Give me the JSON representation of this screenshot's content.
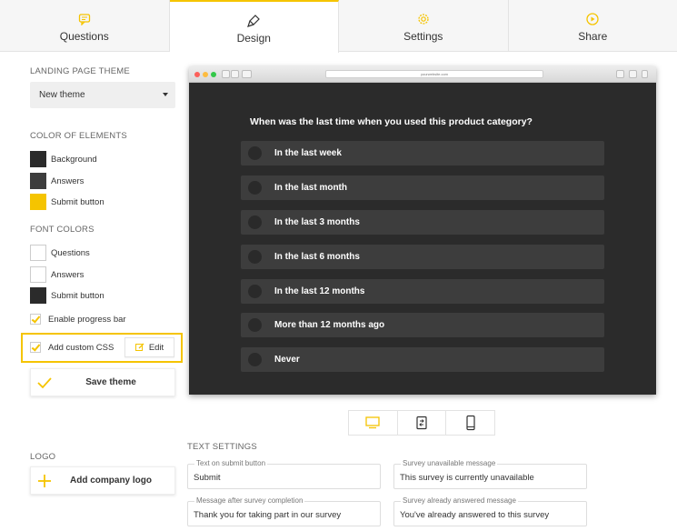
{
  "tabs": [
    {
      "label": "Questions",
      "icon": "chat-icon"
    },
    {
      "label": "Design",
      "icon": "paintbrush-icon"
    },
    {
      "label": "Settings",
      "icon": "gear-icon"
    },
    {
      "label": "Share",
      "icon": "play-circle-icon"
    }
  ],
  "active_tab": "Design",
  "left": {
    "landing_theme_label": "LANDING PAGE THEME",
    "theme_select_value": "New theme",
    "color_elements_label": "COLOR OF ELEMENTS",
    "color_elements": [
      {
        "label": "Background",
        "color": "#2b2b2b"
      },
      {
        "label": "Answers",
        "color": "#3d3d3d"
      },
      {
        "label": "Submit button",
        "color": "#f5c400"
      }
    ],
    "font_colors_label": "FONT COLORS",
    "font_colors": [
      {
        "label": "Questions",
        "color": "#ffffff"
      },
      {
        "label": "Answers",
        "color": "#ffffff"
      },
      {
        "label": "Submit button",
        "color": "#2b2b2b"
      }
    ],
    "progress_bar_label": "Enable progress bar",
    "custom_css_label": "Add custom CSS",
    "edit_label": "Edit",
    "save_theme_label": "Save theme",
    "logo_label": "LOGO",
    "add_logo_label": "Add company logo"
  },
  "preview": {
    "url": "yourwebsite.com",
    "question": "When was the last time when you used this product category?",
    "answers": [
      "In the last week",
      "In the last month",
      "In the last 3 months",
      "In the last 6 months",
      "In the last 12 months",
      "More than 12 months ago",
      "Never"
    ]
  },
  "text_settings": {
    "label": "TEXT SETTINGS",
    "submit_text_label": "Text on submit button",
    "submit_text_value": "Submit",
    "unavailable_label": "Survey unavailable message",
    "unavailable_value": "This survey is currently unavailable",
    "completion_label": "Message after survey completion",
    "completion_value": "Thank you for taking part in our survey",
    "answered_label": "Survey already answered message",
    "answered_value": "You've already answered to this survey"
  },
  "colors": {
    "accent": "#f5c400",
    "dark_bg": "#2b2b2b",
    "answer_bg": "#3d3d3d"
  }
}
